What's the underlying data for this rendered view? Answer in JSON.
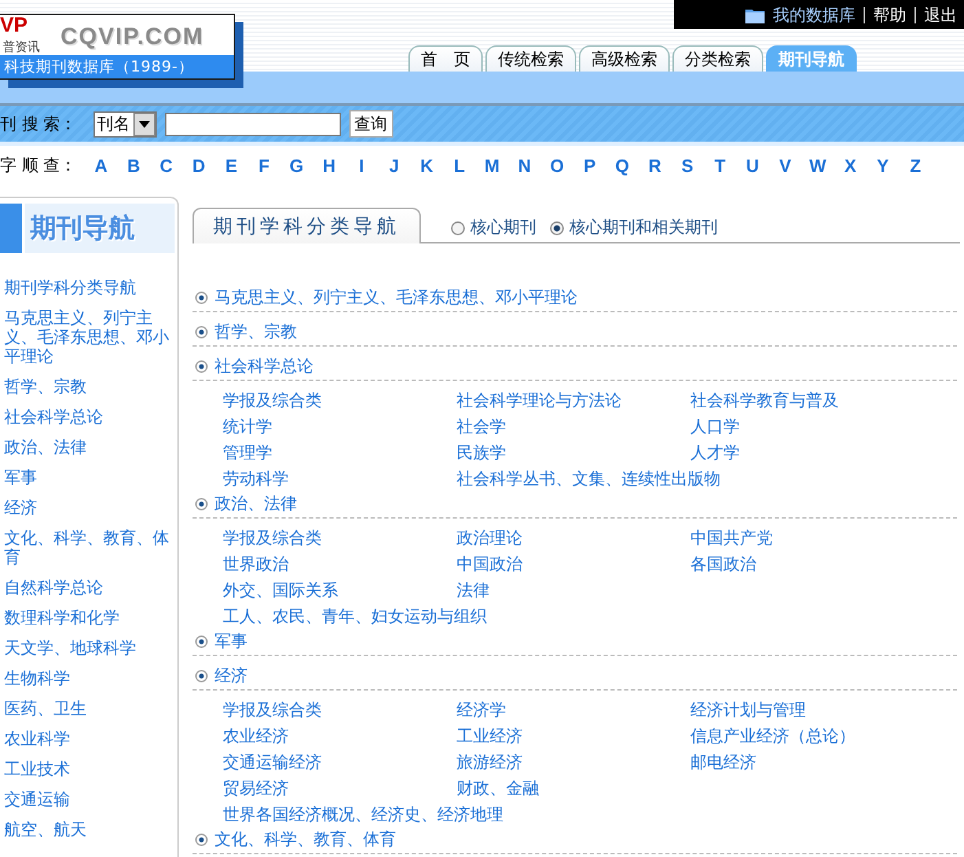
{
  "header": {
    "logo_mark": "VP",
    "logo_company": "普资讯",
    "logo_site": "CQVIP.COM",
    "logo_database": "科技期刊数据库（1989-）"
  },
  "top_links": [
    "我的数据库",
    "帮助",
    "退出"
  ],
  "tabs": [
    {
      "label": "首　页",
      "selected": false
    },
    {
      "label": "传统检索",
      "selected": false
    },
    {
      "label": "高级检索",
      "selected": false
    },
    {
      "label": "分类检索",
      "selected": false
    },
    {
      "label": "期刊导航",
      "selected": true
    }
  ],
  "search": {
    "label": "刊 搜 索：",
    "field_select": "刊名",
    "button": "查询"
  },
  "alphabet": {
    "label": "字 顺 查：",
    "letters": [
      "A",
      "B",
      "C",
      "D",
      "E",
      "F",
      "G",
      "H",
      "I",
      "J",
      "K",
      "L",
      "M",
      "N",
      "O",
      "P",
      "Q",
      "R",
      "S",
      "T",
      "U",
      "V",
      "W",
      "X",
      "Y",
      "Z"
    ]
  },
  "sidebar": {
    "title": "期刊导航",
    "items": [
      "期刊学科分类导航",
      "马克思主义、列宁主义、毛泽东思想、邓小平理论",
      "哲学、宗教",
      "社会科学总论",
      "政治、法律",
      "军事",
      "经济",
      "文化、科学、教育、体育",
      "自然科学总论",
      "数理科学和化学",
      "天文学、地球科学",
      "生物科学",
      "医药、卫生",
      "农业科学",
      "工业技术",
      "交通运输",
      "航空、航天"
    ]
  },
  "content": {
    "tab": "期刊学科分类导航",
    "filters": [
      {
        "label": "核心期刊",
        "selected": false
      },
      {
        "label": "核心期刊和相关期刊",
        "selected": true
      }
    ],
    "sections": [
      {
        "title": "马克思主义、列宁主义、毛泽东思想、邓小平理论"
      },
      {
        "title": "哲学、宗教"
      },
      {
        "title": "社会科学总论",
        "subcategory_rows": [
          [
            "学报及综合类",
            "社会科学理论与方法论",
            "社会科学教育与普及"
          ],
          [
            "统计学",
            "社会学",
            "人口学"
          ],
          [
            "管理学",
            "民族学",
            "人才学"
          ],
          [
            "劳动科学",
            "社会科学丛书、文集、连续性出版物"
          ]
        ]
      },
      {
        "title": "政治、法律",
        "subcategory_rows": [
          [
            "学报及综合类",
            "政治理论",
            "中国共产党"
          ],
          [
            "世界政治",
            "中国政治",
            "各国政治"
          ],
          [
            "外交、国际关系",
            "法律"
          ],
          [
            "工人、农民、青年、妇女运动与组织"
          ]
        ]
      },
      {
        "title": "军事"
      },
      {
        "title": "经济",
        "subcategory_rows": [
          [
            "学报及综合类",
            "经济学",
            "经济计划与管理"
          ],
          [
            "农业经济",
            "工业经济",
            "信息产业经济（总论）"
          ],
          [
            "交通运输经济",
            "旅游经济",
            "邮电经济"
          ],
          [
            "贸易经济",
            "财政、金融"
          ],
          [
            "世界各国经济概况、经济史、经济地理"
          ]
        ]
      },
      {
        "title": "文化、科学、教育、体育"
      }
    ]
  }
}
